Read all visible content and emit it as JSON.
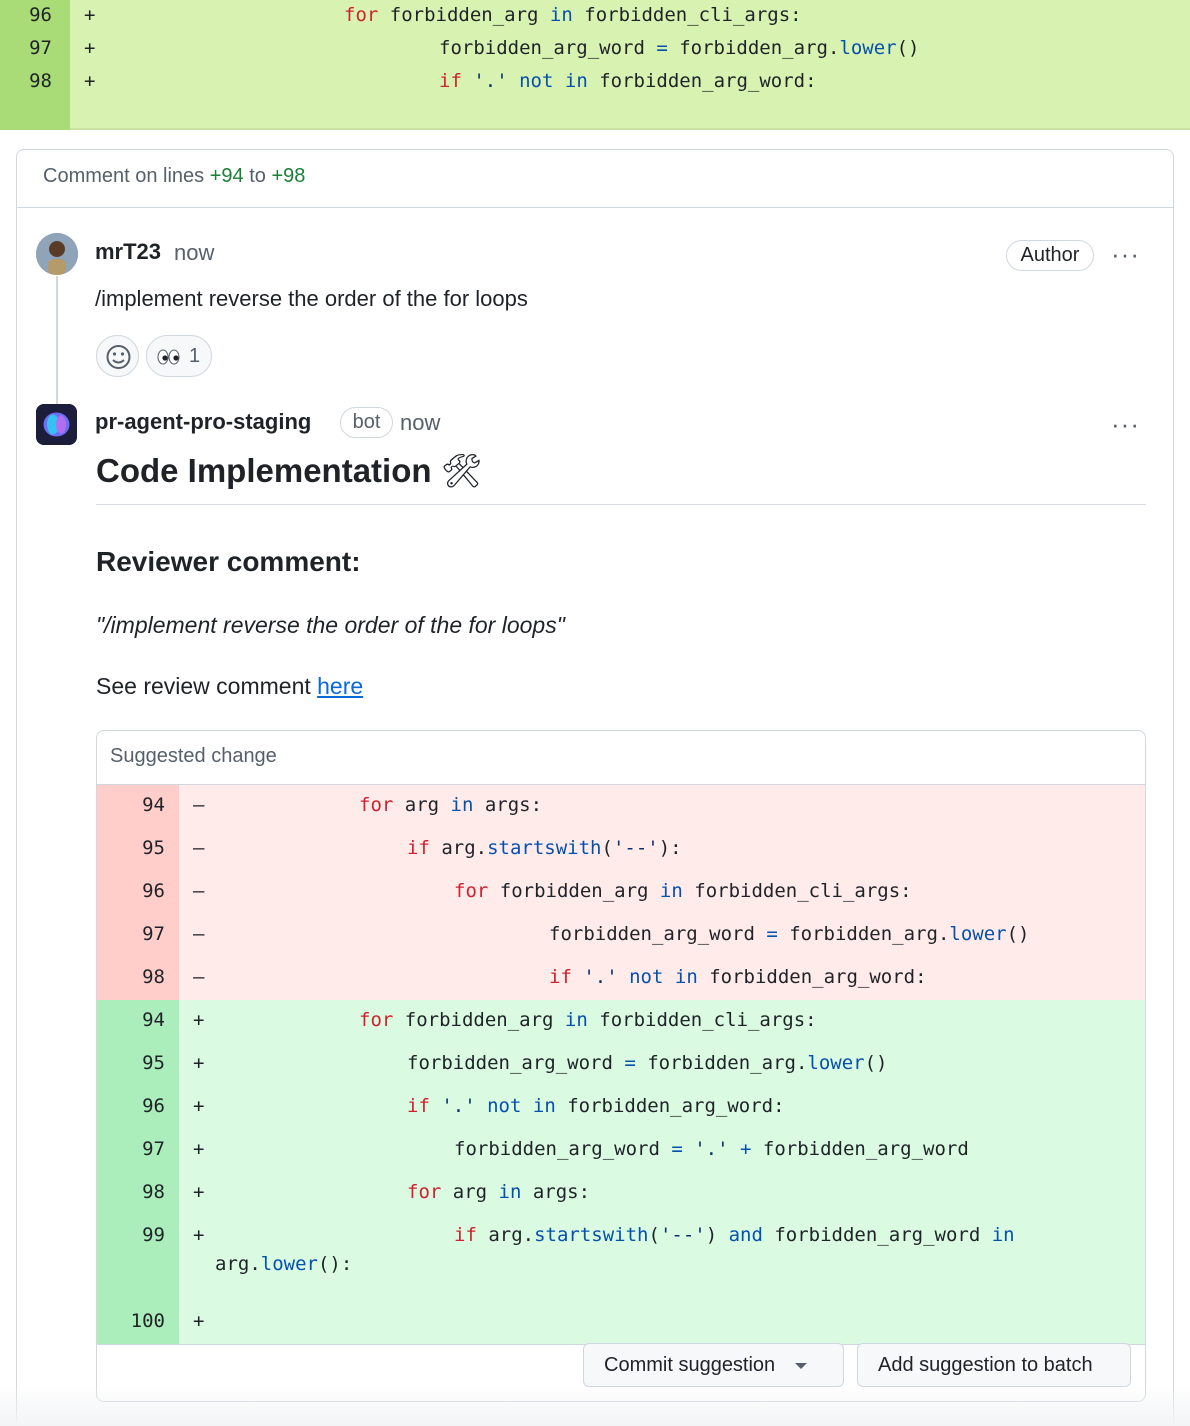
{
  "top_diff": {
    "rows": [
      {
        "line": "96",
        "sign": "+",
        "indent": 244,
        "tokens": [
          {
            "t": "for",
            "c": "kw"
          },
          {
            "t": " forbidden_arg ",
            "c": ""
          },
          {
            "t": "in",
            "c": "bl"
          },
          {
            "t": " forbidden_cli_args:",
            "c": ""
          }
        ]
      },
      {
        "line": "97",
        "sign": "+",
        "indent": 339,
        "tokens": [
          {
            "t": "forbidden_arg_word ",
            "c": ""
          },
          {
            "t": "=",
            "c": "bl"
          },
          {
            "t": " forbidden_arg.",
            "c": ""
          },
          {
            "t": "lower",
            "c": "bl"
          },
          {
            "t": "()",
            "c": ""
          }
        ]
      },
      {
        "line": "98",
        "sign": "+",
        "indent": 339,
        "tokens": [
          {
            "t": "if",
            "c": "kw"
          },
          {
            "t": " '.' ",
            "c": "st"
          },
          {
            "t": "not",
            "c": "bl"
          },
          {
            "t": " ",
            "c": ""
          },
          {
            "t": "in",
            "c": "bl"
          },
          {
            "t": " forbidden_arg_word:",
            "c": ""
          }
        ]
      }
    ]
  },
  "comment": {
    "header_prefix": "Comment on lines ",
    "from": "+94",
    "to_word": " to ",
    "to": "+98"
  },
  "first_comment": {
    "user": "mrT23",
    "time": "now",
    "badge": "Author",
    "more": "···",
    "text": "/implement reverse the order of the for loops",
    "reaction_count": "1"
  },
  "bot_comment": {
    "user": "pr-agent-pro-staging",
    "badge": "bot",
    "time": "now",
    "more": "···",
    "title": "Code Implementation",
    "title_icon": "🛠",
    "subheading": "Reviewer comment:",
    "quote": "\"/implement reverse the order of the for loops\"",
    "see_text": "See review comment ",
    "see_link": "here"
  },
  "suggested_change": {
    "label": "Suggested change",
    "deleted": [
      {
        "line": "94",
        "indent": 262,
        "tokens": [
          {
            "t": "for",
            "c": "kw"
          },
          {
            "t": " arg ",
            "c": ""
          },
          {
            "t": "in",
            "c": "bl"
          },
          {
            "t": " args:",
            "c": ""
          }
        ]
      },
      {
        "line": "95",
        "indent": 310,
        "tokens": [
          {
            "t": "if",
            "c": "kw"
          },
          {
            "t": " arg.",
            "c": ""
          },
          {
            "t": "startswith",
            "c": "bl"
          },
          {
            "t": "(",
            "c": ""
          },
          {
            "t": "'--'",
            "c": "st"
          },
          {
            "t": "):",
            "c": ""
          }
        ]
      },
      {
        "line": "96",
        "indent": 357,
        "tokens": [
          {
            "t": "for",
            "c": "kw"
          },
          {
            "t": " forbidden_arg ",
            "c": ""
          },
          {
            "t": "in",
            "c": "bl"
          },
          {
            "t": " forbidden_cli_args:",
            "c": ""
          }
        ]
      },
      {
        "line": "97",
        "indent": 452,
        "tokens": [
          {
            "t": "forbidden_arg_word ",
            "c": ""
          },
          {
            "t": "=",
            "c": "bl"
          },
          {
            "t": " forbidden_arg.",
            "c": ""
          },
          {
            "t": "lower",
            "c": "bl"
          },
          {
            "t": "()",
            "c": ""
          }
        ]
      },
      {
        "line": "98",
        "indent": 452,
        "tokens": [
          {
            "t": "if",
            "c": "kw"
          },
          {
            "t": " '.' ",
            "c": "st"
          },
          {
            "t": "not",
            "c": "bl"
          },
          {
            "t": " ",
            "c": ""
          },
          {
            "t": "in",
            "c": "bl"
          },
          {
            "t": " forbidden_arg_word:",
            "c": ""
          }
        ]
      }
    ],
    "added": [
      {
        "line": "94",
        "indent": 262,
        "tokens": [
          {
            "t": "for",
            "c": "kw"
          },
          {
            "t": " forbidden_arg ",
            "c": ""
          },
          {
            "t": "in",
            "c": "bl"
          },
          {
            "t": " forbidden_cli_args:",
            "c": ""
          }
        ]
      },
      {
        "line": "95",
        "indent": 310,
        "tokens": [
          {
            "t": "forbidden_arg_word ",
            "c": ""
          },
          {
            "t": "=",
            "c": "bl"
          },
          {
            "t": " forbidden_arg.",
            "c": ""
          },
          {
            "t": "lower",
            "c": "bl"
          },
          {
            "t": "()",
            "c": ""
          }
        ]
      },
      {
        "line": "96",
        "indent": 310,
        "tokens": [
          {
            "t": "if",
            "c": "kw"
          },
          {
            "t": " '.' ",
            "c": "st"
          },
          {
            "t": "not",
            "c": "bl"
          },
          {
            "t": " ",
            "c": ""
          },
          {
            "t": "in",
            "c": "bl"
          },
          {
            "t": " forbidden_arg_word:",
            "c": ""
          }
        ]
      },
      {
        "line": "97",
        "indent": 357,
        "tokens": [
          {
            "t": "forbidden_arg_word ",
            "c": ""
          },
          {
            "t": "=",
            "c": "bl"
          },
          {
            "t": " '.' ",
            "c": "st"
          },
          {
            "t": "+",
            "c": "bl"
          },
          {
            "t": " forbidden_arg_word",
            "c": ""
          }
        ]
      },
      {
        "line": "98",
        "indent": 310,
        "tokens": [
          {
            "t": "for",
            "c": "kw"
          },
          {
            "t": " arg ",
            "c": ""
          },
          {
            "t": "in",
            "c": "bl"
          },
          {
            "t": " args:",
            "c": ""
          }
        ]
      },
      {
        "line": "99",
        "indent": 357,
        "tokens": [
          {
            "t": "if",
            "c": "kw"
          },
          {
            "t": " arg.",
            "c": ""
          },
          {
            "t": "startswith",
            "c": "bl"
          },
          {
            "t": "(",
            "c": ""
          },
          {
            "t": "'--'",
            "c": "st"
          },
          {
            "t": ") ",
            "c": ""
          },
          {
            "t": "and",
            "c": "bl"
          },
          {
            "t": " forbidden_arg_word ",
            "c": ""
          },
          {
            "t": "in",
            "c": "bl"
          }
        ],
        "wrap_tokens": [
          {
            "t": "arg.",
            "c": ""
          },
          {
            "t": "lower",
            "c": "bl"
          },
          {
            "t": "():",
            "c": ""
          }
        ]
      },
      {
        "line": "100",
        "indent": 0,
        "tokens": []
      }
    ],
    "commit_label": "Commit suggestion",
    "batch_label": "Add suggestion to batch"
  }
}
